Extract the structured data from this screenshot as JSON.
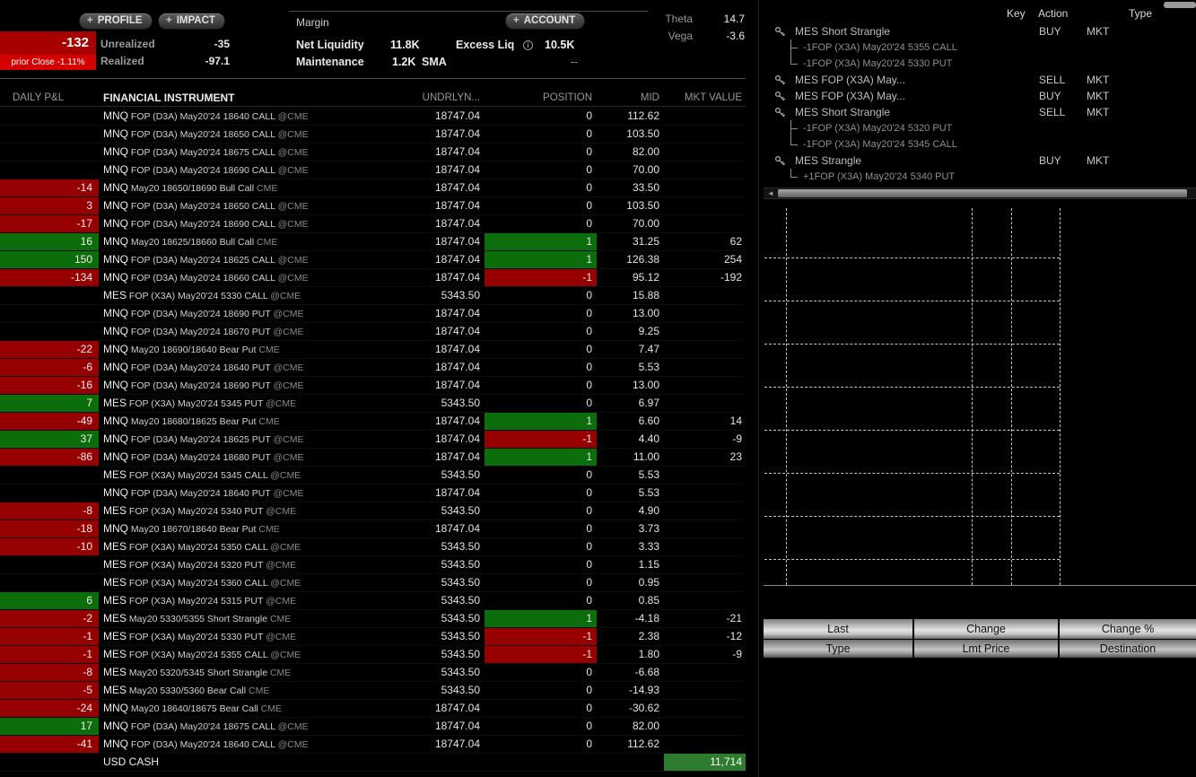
{
  "colors": {
    "negative_cell": "#970000",
    "positive_cell": "#0b6e0b",
    "cash_cell": "#2e7d2e",
    "pnl_block": "#a80000",
    "prior_strip": "#d40000"
  },
  "icons": {
    "plus": "+",
    "info": "i",
    "scroll_left": "◄"
  },
  "topbar": {
    "profile_label": "PROFILE",
    "impact_label": "IMPACT",
    "account_label": "ACCOUNT",
    "margin_label": "Margin",
    "daily_pnl": "-132",
    "prior_close": "prior Close -1.11%",
    "unrealized_label": "Unrealized",
    "unrealized_value": "-35",
    "realized_label": "Realized",
    "realized_value": "-97.1",
    "net_liquidity_label": "Net Liquidity",
    "net_liquidity_value": "11.8K",
    "excess_liq_label": "Excess Liq",
    "excess_liq_value": "10.5K",
    "maintenance_label": "Maintenance",
    "maintenance_value": "1.2K",
    "sma_label": "SMA",
    "sma_value": "--",
    "theta_label": "Theta",
    "theta_value": "14.7",
    "vega_label": "Vega",
    "vega_value": "-3.6"
  },
  "portfolio": {
    "columns": [
      "DAILY P&L",
      "FINANCIAL INSTRUMENT",
      "UNDRLYN...",
      "POSITION",
      "MID",
      "MKT VALUE"
    ],
    "rows": [
      {
        "pnl": "",
        "pnl_bg": "",
        "symbol": "MNQ",
        "detail": "FOP (D3A) May20'24 18640 CALL",
        "venue": "@CME",
        "underlying": "18747.04",
        "position": "0",
        "mid": "112.62",
        "mkt_value": ""
      },
      {
        "pnl": "",
        "pnl_bg": "",
        "symbol": "MNQ",
        "detail": "FOP (D3A) May20'24 18650 CALL",
        "venue": "@CME",
        "underlying": "18747.04",
        "position": "0",
        "mid": "103.50",
        "mkt_value": ""
      },
      {
        "pnl": "",
        "pnl_bg": "",
        "symbol": "MNQ",
        "detail": "FOP (D3A) May20'24 18675 CALL",
        "venue": "@CME",
        "underlying": "18747.04",
        "position": "0",
        "mid": "82.00",
        "mkt_value": ""
      },
      {
        "pnl": "",
        "pnl_bg": "",
        "symbol": "MNQ",
        "detail": "FOP (D3A) May20'24 18690 CALL",
        "venue": "@CME",
        "underlying": "18747.04",
        "position": "0",
        "mid": "70.00",
        "mkt_value": ""
      },
      {
        "pnl": "-14",
        "pnl_bg": "red",
        "symbol": "MNQ",
        "detail": "May20 18650/18690 Bull Call",
        "venue": "CME",
        "underlying": "18747.04",
        "position": "0",
        "mid": "33.50",
        "mkt_value": ""
      },
      {
        "pnl": "3",
        "pnl_bg": "red",
        "symbol": "MNQ",
        "detail": "FOP (D3A) May20'24 18650 CALL",
        "venue": "@CME",
        "underlying": "18747.04",
        "position": "0",
        "mid": "103.50",
        "mkt_value": ""
      },
      {
        "pnl": "-17",
        "pnl_bg": "red",
        "symbol": "MNQ",
        "detail": "FOP (D3A) May20'24 18690 CALL",
        "venue": "@CME",
        "underlying": "18747.04",
        "position": "0",
        "mid": "70.00",
        "mkt_value": ""
      },
      {
        "pnl": "16",
        "pnl_bg": "green",
        "symbol": "MNQ",
        "detail": "May20 18625/18660 Bull Call",
        "venue": "CME",
        "underlying": "18747.04",
        "position": "1",
        "mid": "31.25",
        "mkt_value": "62"
      },
      {
        "pnl": "150",
        "pnl_bg": "green",
        "symbol": "MNQ",
        "detail": "FOP (D3A) May20'24 18625 CALL",
        "venue": "@CME",
        "underlying": "18747.04",
        "position": "1",
        "mid": "126.38",
        "mkt_value": "254"
      },
      {
        "pnl": "-134",
        "pnl_bg": "red",
        "symbol": "MNQ",
        "detail": "FOP (D3A) May20'24 18660 CALL",
        "venue": "@CME",
        "underlying": "18747.04",
        "position": "-1",
        "mid": "95.12",
        "mkt_value": "-192"
      },
      {
        "pnl": "",
        "pnl_bg": "",
        "symbol": "MES",
        "detail": "FOP (X3A) May20'24 5330 CALL",
        "venue": "@CME",
        "underlying": "5343.50",
        "position": "0",
        "mid": "15.88",
        "mkt_value": ""
      },
      {
        "pnl": "",
        "pnl_bg": "",
        "symbol": "MNQ",
        "detail": "FOP (D3A) May20'24 18690 PUT",
        "venue": "@CME",
        "underlying": "18747.04",
        "position": "0",
        "mid": "13.00",
        "mkt_value": ""
      },
      {
        "pnl": "",
        "pnl_bg": "",
        "symbol": "MNQ",
        "detail": "FOP (D3A) May20'24 18670 PUT",
        "venue": "@CME",
        "underlying": "18747.04",
        "position": "0",
        "mid": "9.25",
        "mkt_value": ""
      },
      {
        "pnl": "-22",
        "pnl_bg": "red",
        "symbol": "MNQ",
        "detail": "May20 18690/18640 Bear Put",
        "venue": "CME",
        "underlying": "18747.04",
        "position": "0",
        "mid": "7.47",
        "mkt_value": ""
      },
      {
        "pnl": "-6",
        "pnl_bg": "red",
        "symbol": "MNQ",
        "detail": "FOP (D3A) May20'24 18640 PUT",
        "venue": "@CME",
        "underlying": "18747.04",
        "position": "0",
        "mid": "5.53",
        "mkt_value": ""
      },
      {
        "pnl": "-16",
        "pnl_bg": "red",
        "symbol": "MNQ",
        "detail": "FOP (D3A) May20'24 18690 PUT",
        "venue": "@CME",
        "underlying": "18747.04",
        "position": "0",
        "mid": "13.00",
        "mkt_value": ""
      },
      {
        "pnl": "7",
        "pnl_bg": "green",
        "symbol": "MES",
        "detail": "FOP (X3A) May20'24 5345 PUT",
        "venue": "@CME",
        "underlying": "5343.50",
        "position": "0",
        "mid": "6.97",
        "mkt_value": ""
      },
      {
        "pnl": "-49",
        "pnl_bg": "red",
        "symbol": "MNQ",
        "detail": "May20 18680/18625 Bear Put",
        "venue": "CME",
        "underlying": "18747.04",
        "position": "1",
        "mid": "6.60",
        "mkt_value": "14"
      },
      {
        "pnl": "37",
        "pnl_bg": "green",
        "symbol": "MNQ",
        "detail": "FOP (D3A) May20'24 18625 PUT",
        "venue": "@CME",
        "underlying": "18747.04",
        "position": "-1",
        "mid": "4.40",
        "mkt_value": "-9"
      },
      {
        "pnl": "-86",
        "pnl_bg": "red",
        "symbol": "MNQ",
        "detail": "FOP (D3A) May20'24 18680 PUT",
        "venue": "@CME",
        "underlying": "18747.04",
        "position": "1",
        "mid": "11.00",
        "mkt_value": "23"
      },
      {
        "pnl": "",
        "pnl_bg": "",
        "symbol": "MES",
        "detail": "FOP (X3A) May20'24 5345 CALL",
        "venue": "@CME",
        "underlying": "5343.50",
        "position": "0",
        "mid": "5.53",
        "mkt_value": ""
      },
      {
        "pnl": "",
        "pnl_bg": "",
        "symbol": "MNQ",
        "detail": "FOP (D3A) May20'24 18640 PUT",
        "venue": "@CME",
        "underlying": "18747.04",
        "position": "0",
        "mid": "5.53",
        "mkt_value": ""
      },
      {
        "pnl": "-8",
        "pnl_bg": "red",
        "symbol": "MES",
        "detail": "FOP (X3A) May20'24 5340 PUT",
        "venue": "@CME",
        "underlying": "5343.50",
        "position": "0",
        "mid": "4.90",
        "mkt_value": ""
      },
      {
        "pnl": "-18",
        "pnl_bg": "red",
        "symbol": "MNQ",
        "detail": "May20 18670/18640 Bear Put",
        "venue": "CME",
        "underlying": "18747.04",
        "position": "0",
        "mid": "3.73",
        "mkt_value": ""
      },
      {
        "pnl": "-10",
        "pnl_bg": "red",
        "symbol": "MES",
        "detail": "FOP (X3A) May20'24 5350 CALL",
        "venue": "@CME",
        "underlying": "5343.50",
        "position": "0",
        "mid": "3.33",
        "mkt_value": ""
      },
      {
        "pnl": "",
        "pnl_bg": "",
        "symbol": "MES",
        "detail": "FOP (X3A) May20'24 5320 PUT",
        "venue": "@CME",
        "underlying": "5343.50",
        "position": "0",
        "mid": "1.15",
        "mkt_value": ""
      },
      {
        "pnl": "",
        "pnl_bg": "",
        "symbol": "MES",
        "detail": "FOP (X3A) May20'24 5360 CALL",
        "venue": "@CME",
        "underlying": "5343.50",
        "position": "0",
        "mid": "0.95",
        "mkt_value": ""
      },
      {
        "pnl": "6",
        "pnl_bg": "green",
        "symbol": "MES",
        "detail": "FOP (X3A) May20'24 5315 PUT",
        "venue": "@CME",
        "underlying": "5343.50",
        "position": "0",
        "mid": "0.85",
        "mkt_value": ""
      },
      {
        "pnl": "-2",
        "pnl_bg": "red",
        "symbol": "MES",
        "detail": "May20 5330/5355 Short Strangle",
        "venue": "CME",
        "underlying": "5343.50",
        "position": "1",
        "mid": "-4.18",
        "mkt_value": "-21"
      },
      {
        "pnl": "-1",
        "pnl_bg": "red",
        "symbol": "MES",
        "detail": "FOP (X3A) May20'24 5330 PUT",
        "venue": "@CME",
        "underlying": "5343.50",
        "position": "-1",
        "mid": "2.38",
        "mkt_value": "-12"
      },
      {
        "pnl": "-1",
        "pnl_bg": "red",
        "symbol": "MES",
        "detail": "FOP (X3A) May20'24 5355 CALL",
        "venue": "@CME",
        "underlying": "5343.50",
        "position": "-1",
        "mid": "1.80",
        "mkt_value": "-9"
      },
      {
        "pnl": "-8",
        "pnl_bg": "red",
        "symbol": "MES",
        "detail": "May20 5320/5345 Short Strangle",
        "venue": "CME",
        "underlying": "5343.50",
        "position": "0",
        "mid": "-6.68",
        "mkt_value": ""
      },
      {
        "pnl": "-5",
        "pnl_bg": "red",
        "symbol": "MES",
        "detail": "May20 5330/5360 Bear Call",
        "venue": "CME",
        "underlying": "5343.50",
        "position": "0",
        "mid": "-14.93",
        "mkt_value": ""
      },
      {
        "pnl": "-24",
        "pnl_bg": "red",
        "symbol": "MNQ",
        "detail": "May20 18640/18675 Bear Call",
        "venue": "CME",
        "underlying": "18747.04",
        "position": "0",
        "mid": "-30.62",
        "mkt_value": ""
      },
      {
        "pnl": "17",
        "pnl_bg": "green",
        "symbol": "MNQ",
        "detail": "FOP (D3A) May20'24 18675 CALL",
        "venue": "@CME",
        "underlying": "18747.04",
        "position": "0",
        "mid": "82.00",
        "mkt_value": ""
      },
      {
        "pnl": "-41",
        "pnl_bg": "red",
        "symbol": "MNQ",
        "detail": "FOP (D3A) May20'24 18640 CALL",
        "venue": "@CME",
        "underlying": "18747.04",
        "position": "0",
        "mid": "112.62",
        "mkt_value": ""
      }
    ],
    "cash_row": {
      "label": "USD CASH",
      "value": "11,714"
    }
  },
  "orders": {
    "header": {
      "key": "Key",
      "action": "Action",
      "type": "Type"
    },
    "rows": [
      {
        "kind": "parent",
        "label": "MES Short Strangle",
        "action": "BUY",
        "order_type": "MKT"
      },
      {
        "kind": "leg",
        "branch": "mid",
        "label": "-1FOP (X3A) May20'24 5355 CALL"
      },
      {
        "kind": "leg",
        "branch": "end",
        "label": "-1FOP (X3A) May20'24 5330 PUT"
      },
      {
        "kind": "parent",
        "label": "MES FOP (X3A) May...",
        "action": "SELL",
        "order_type": "MKT"
      },
      {
        "kind": "parent",
        "label": "MES FOP (X3A) May...",
        "action": "BUY",
        "order_type": "MKT"
      },
      {
        "kind": "parent",
        "label": "MES Short Strangle",
        "action": "SELL",
        "order_type": "MKT"
      },
      {
        "kind": "leg",
        "branch": "mid",
        "label": "-1FOP (X3A) May20'24 5320 PUT"
      },
      {
        "kind": "leg",
        "branch": "end",
        "label": "-1FOP (X3A) May20'24 5345 CALL"
      },
      {
        "kind": "parent",
        "label": "MES Strangle",
        "action": "BUY",
        "order_type": "MKT"
      },
      {
        "kind": "leg",
        "branch": "end",
        "label": "+1FOP (X3A) May20'24 5340 PUT"
      }
    ]
  },
  "quote_panel": {
    "row1": [
      "Last",
      "Change",
      "Change %"
    ],
    "row2": [
      "Type",
      "Lmt Price",
      "Destination"
    ]
  }
}
